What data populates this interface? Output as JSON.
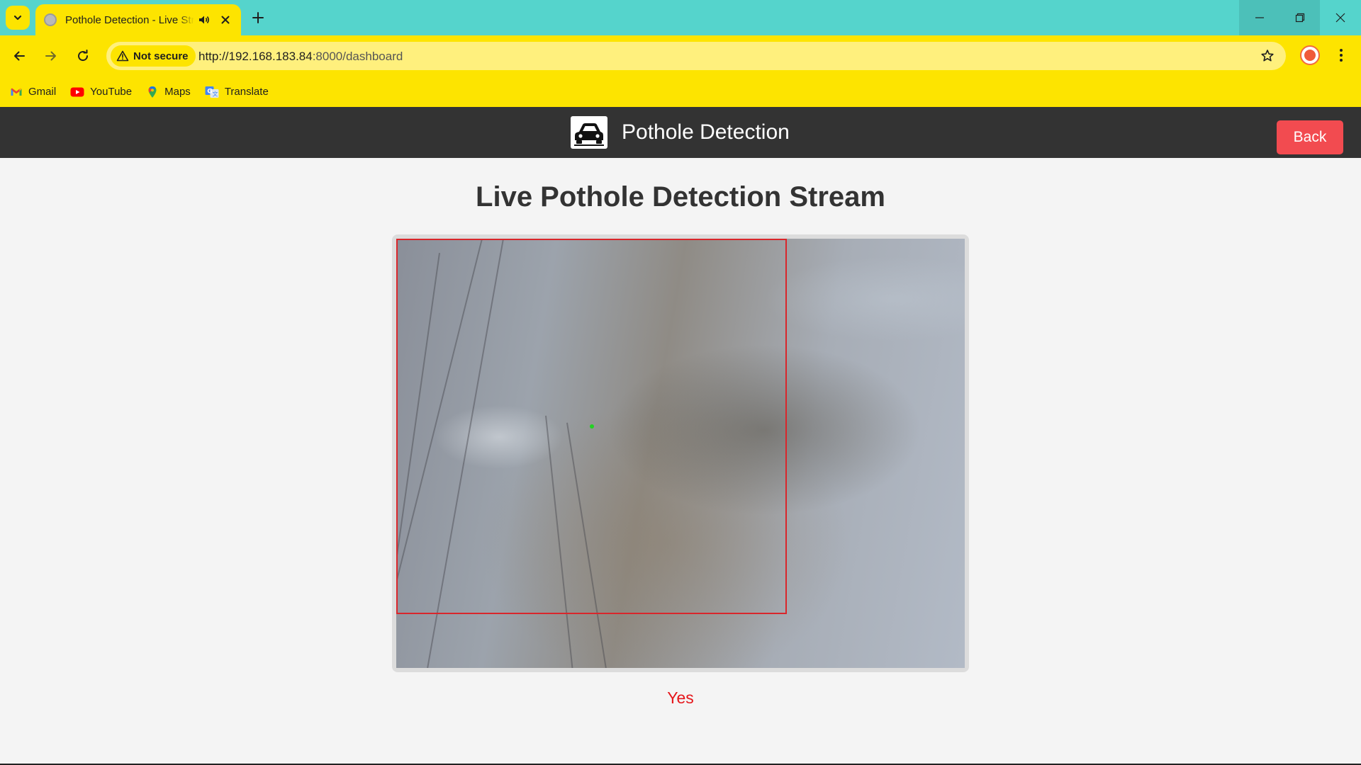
{
  "browser": {
    "tab": {
      "title": "Pothole Detection - Live Stream"
    },
    "omnibox": {
      "security_label": "Not secure",
      "url_host": "http://192.168.183.84",
      "url_rest": ":8000/dashboard"
    },
    "bookmarks": [
      {
        "label": "Gmail",
        "icon": "gmail-icon"
      },
      {
        "label": "YouTube",
        "icon": "youtube-icon"
      },
      {
        "label": "Maps",
        "icon": "maps-icon"
      },
      {
        "label": "Translate",
        "icon": "translate-icon"
      }
    ],
    "theme": {
      "tabbar_color": "#55d4cc",
      "toolbar_color": "#fde400"
    }
  },
  "header": {
    "title": "Pothole Detection",
    "back_label": "Back",
    "logo_icon": "car-icon",
    "background": "#333333",
    "back_color": "#f24b50"
  },
  "main": {
    "heading": "Live Pothole Detection Stream",
    "stream": {
      "detection_box_color": "#d9262b",
      "center_marker_color": "#22d322"
    },
    "status": "Yes",
    "status_color": "#e5161b"
  }
}
